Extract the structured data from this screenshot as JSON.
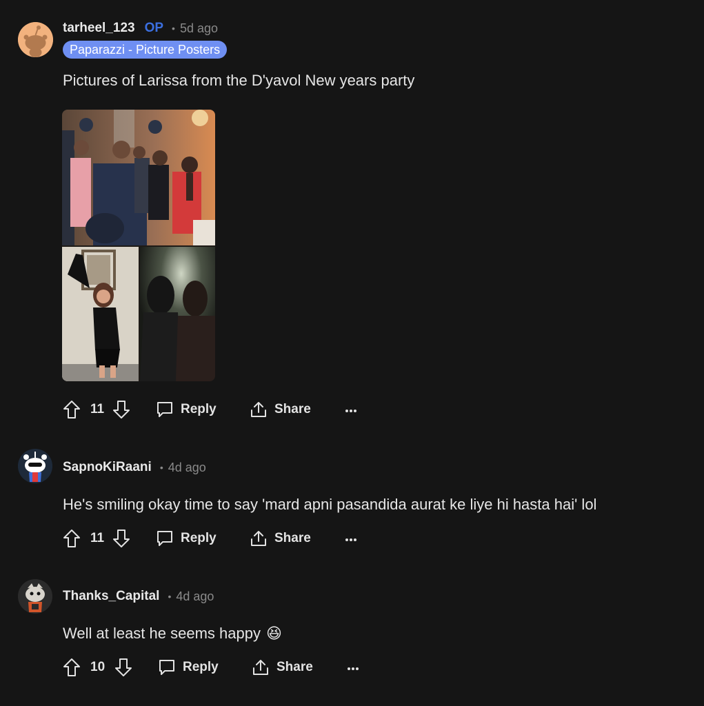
{
  "comments": [
    {
      "username": "tarheel_123",
      "op_badge": "OP",
      "age": "5d ago",
      "flair": "Paparazzi - Picture Posters",
      "text": "Pictures of Larissa from the D'yavol New years party",
      "votes": "11",
      "reply_label": "Reply",
      "share_label": "Share"
    },
    {
      "username": "SapnoKiRaani",
      "age": "4d ago",
      "text": "He's smiling okay time to say 'mard apni pasandida aurat ke liye hi hasta hai' lol",
      "votes": "11",
      "reply_label": "Reply",
      "share_label": "Share"
    },
    {
      "username": "Thanks_Capital",
      "age": "4d ago",
      "text": "Well at least he seems happy",
      "emoji": "😆",
      "votes": "10",
      "reply_label": "Reply",
      "share_label": "Share"
    }
  ],
  "icons": {
    "upvote": "arrow-up-icon",
    "downvote": "arrow-down-icon",
    "reply": "speech-bubble-icon",
    "share": "share-upload-icon",
    "more": "ellipsis-icon"
  },
  "colors": {
    "background": "#151515",
    "op_badge": "#3b6fe0",
    "flair_bg": "#6f8ff2",
    "muted": "#8a8a8a"
  }
}
